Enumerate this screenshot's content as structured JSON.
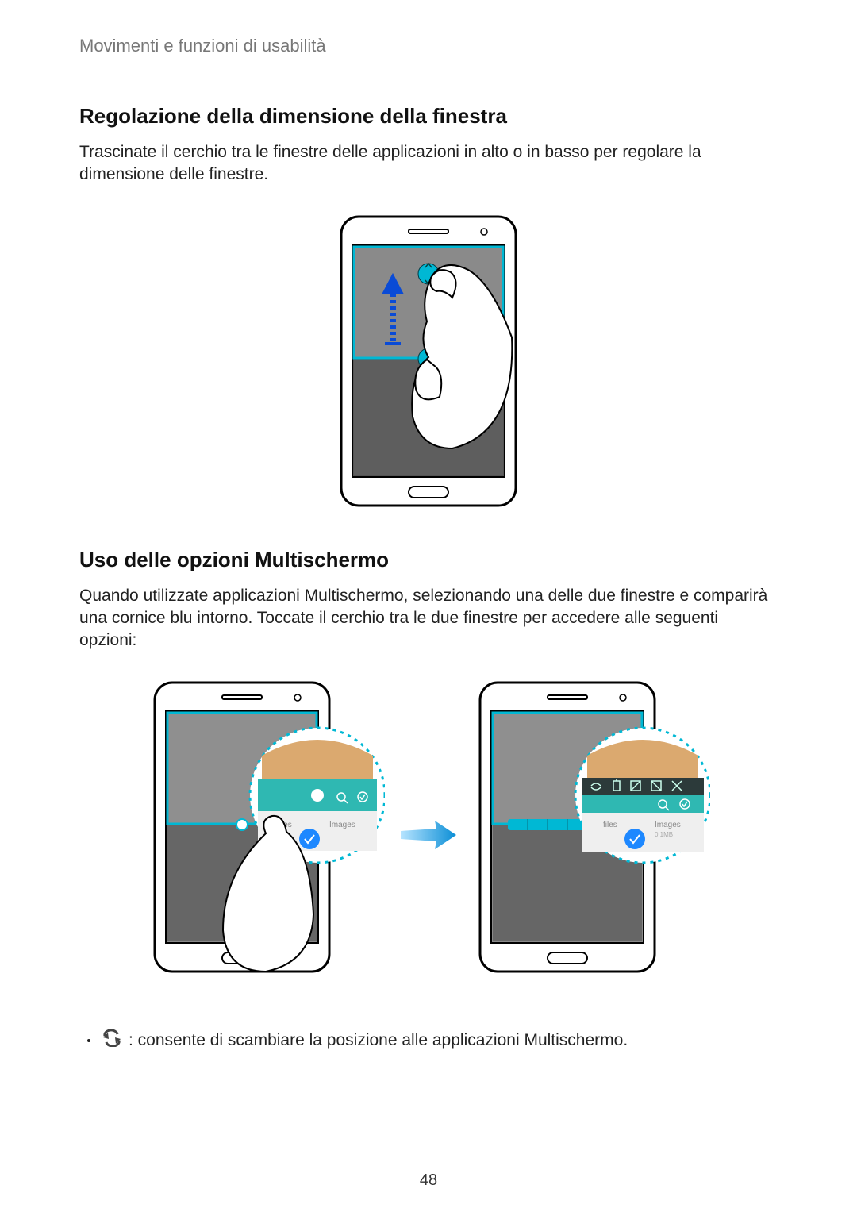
{
  "header": "Movimenti e funzioni di usabilità",
  "section1": {
    "title": "Regolazione della dimensione della finestra",
    "body": "Trascinate il cerchio tra le finestre delle applicazioni in alto o in basso per regolare la dimensione delle finestre."
  },
  "section2": {
    "title": "Uso delle opzioni Multischermo",
    "body": "Quando utilizzate applicazioni Multischermo, selezionando una delle due finestre e comparirà una cornice blu intorno. Toccate il cerchio tra le due finestre per accedere alle seguenti opzioni:",
    "bullet_text": " : consente di scambiare la posizione alle applicazioni Multischermo."
  },
  "page_number": "48"
}
